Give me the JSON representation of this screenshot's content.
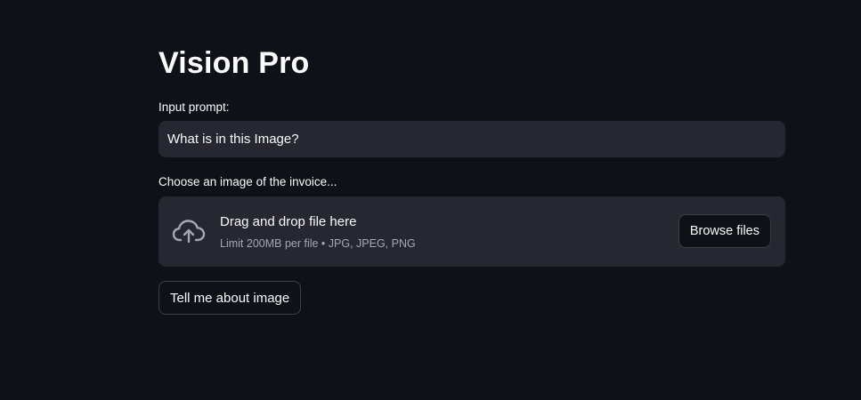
{
  "page": {
    "title": "Vision Pro",
    "background_color": "#0e1117"
  },
  "prompt": {
    "label": "Input prompt:",
    "value": "What is in this Image?"
  },
  "uploader": {
    "label": "Choose an image of the invoice...",
    "drop_title": "Drag and drop file here",
    "limit_text": "Limit 200MB per file • JPG, JPEG, PNG",
    "browse_label": "Browse files",
    "icon": "cloud-upload-icon"
  },
  "submit": {
    "label": "Tell me about image"
  }
}
